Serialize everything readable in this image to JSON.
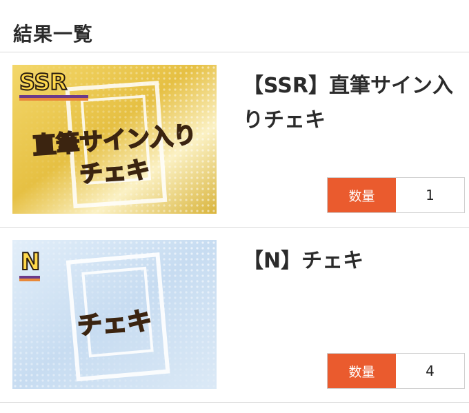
{
  "header": {
    "title": "結果一覧"
  },
  "items": [
    {
      "name": "【SSR】直筆サイン入りチェキ",
      "thumb_rarity": "SSR",
      "thumb_line1": "直筆サイン入り",
      "thumb_line2": "チェキ",
      "qty_label": "数量",
      "qty_value": "1",
      "theme": "gold"
    },
    {
      "name": "【N】チェキ",
      "thumb_rarity": "N",
      "thumb_line1": "チェキ",
      "qty_label": "数量",
      "qty_value": "4",
      "theme": "blue"
    }
  ],
  "colors": {
    "accent": "#ea5b2e",
    "gold": "#e2bf3a",
    "blue": "#cfe3f5",
    "divider": "#d9d9d9"
  }
}
